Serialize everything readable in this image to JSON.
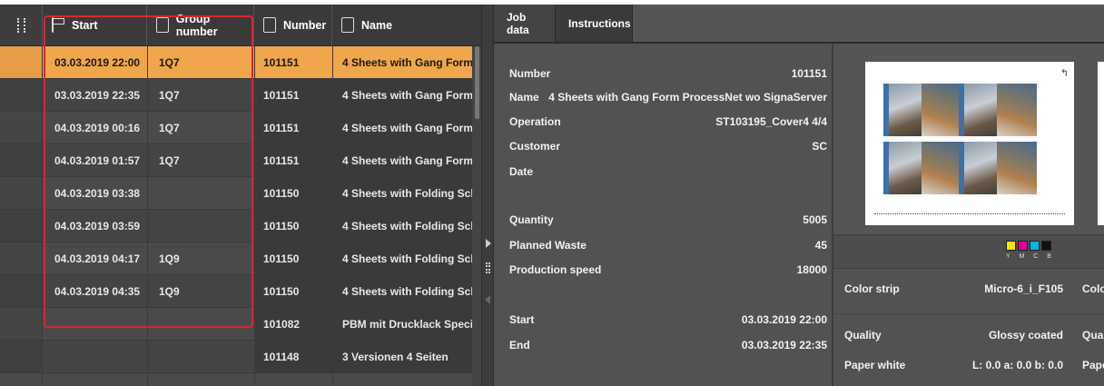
{
  "table": {
    "columns": [
      {
        "label": "Start",
        "icon": "flag-icon"
      },
      {
        "label": "Group number",
        "icon": "group-number-icon"
      },
      {
        "label": "Number",
        "icon": "number-icon"
      },
      {
        "label": "Name",
        "icon": "name-icon"
      }
    ],
    "rows": [
      {
        "start": "03.03.2019 22:00",
        "group": "1Q7",
        "number": "101151",
        "name": "4 Sheets with Gang Form ...",
        "selected": true
      },
      {
        "start": "03.03.2019 22:35",
        "group": "1Q7",
        "number": "101151",
        "name": "4 Sheets with Gang Form ..."
      },
      {
        "start": "04.03.2019 00:16",
        "group": "1Q7",
        "number": "101151",
        "name": "4 Sheets with Gang Form ..."
      },
      {
        "start": "04.03.2019 01:57",
        "group": "1Q7",
        "number": "101151",
        "name": "4 Sheets with Gang Form ..."
      },
      {
        "start": "04.03.2019 03:38",
        "group": "",
        "number": "101150",
        "name": "4 Sheets with Folding Sch..."
      },
      {
        "start": "04.03.2019 03:59",
        "group": "",
        "number": "101150",
        "name": "4 Sheets with Folding Sch..."
      },
      {
        "start": "04.03.2019 04:17",
        "group": "1Q9",
        "number": "101150",
        "name": "4 Sheets with Folding Sch..."
      },
      {
        "start": "04.03.2019 04:35",
        "group": "1Q9",
        "number": "101150",
        "name": "4 Sheets with Folding Sch..."
      },
      {
        "start": "",
        "group": "",
        "number": "101082",
        "name": "PBM mit Drucklack Speci..."
      },
      {
        "start": "",
        "group": "",
        "number": "101148",
        "name": "3 Versionen 4 Seiten"
      }
    ]
  },
  "tabs": [
    "Job data",
    "Instructions"
  ],
  "job": {
    "number_label": "Number",
    "number": "101151",
    "name_label": "Name",
    "name": "4 Sheets with Gang Form ProcessNet wo SignaServer",
    "operation_label": "Operation",
    "operation": "ST103195_Cover4 4/4",
    "customer_label": "Customer",
    "customer": "SC",
    "date_label": "Date",
    "date": "",
    "quantity_label": "Quantity",
    "quantity": "5005",
    "waste_label": "Planned Waste",
    "waste": "45",
    "speed_label": "Production speed",
    "speed": "18000",
    "start_label": "Start",
    "start": "03.03.2019 22:00",
    "end_label": "End",
    "end": "03.03.2019 22:35"
  },
  "print": {
    "swatch_letters": "Y M C B",
    "swatch_colors": [
      "#f5e400",
      "#e0009a",
      "#00b6e8",
      "#111111"
    ],
    "color_strip_label": "Color strip",
    "color_strip": "Micro-6_i_F105",
    "color_strip_cut": "Colo",
    "quality_label": "Quality",
    "quality": "Glossy coated",
    "quality_cut": "Quali",
    "paper_white_label": "Paper white",
    "paper_white": "L: 0.0 a: 0.0 b: 0.0",
    "paper_white_cut": "Pape"
  }
}
